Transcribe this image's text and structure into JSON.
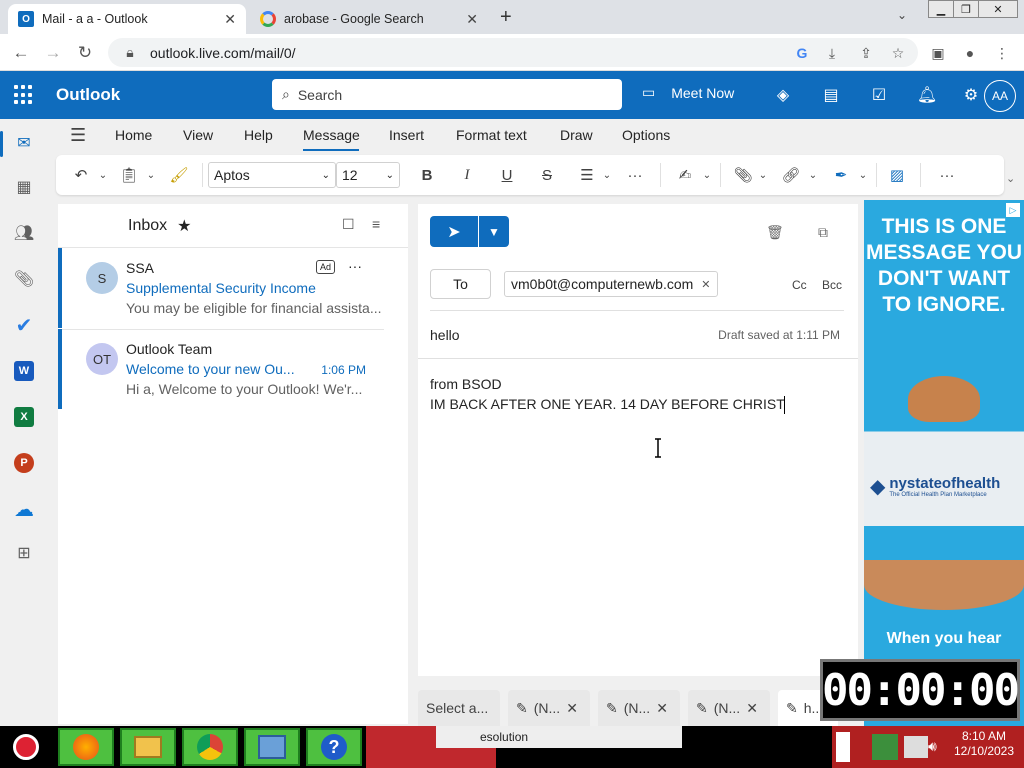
{
  "browser": {
    "tabs": [
      {
        "title": "Mail - a a - Outlook",
        "icon": "outlook-favicon"
      },
      {
        "title": "arobase - Google Search",
        "icon": "google-favicon"
      }
    ],
    "new_tab": "+",
    "url": "outlook.live.com/mail/0/"
  },
  "outlook": {
    "brand": "Outlook",
    "search_placeholder": "Search",
    "meet_now": "Meet Now",
    "avatar_initials": "AA",
    "ribbon_tabs": [
      "Home",
      "View",
      "Help",
      "Message",
      "Insert",
      "Format text",
      "Draw",
      "Options"
    ],
    "font_name": "Aptos",
    "font_size": "12",
    "format_buttons": {
      "bold": "B",
      "italic": "I",
      "underline": "U",
      "strike": "S"
    },
    "more": "···"
  },
  "maillist": {
    "folder": "Inbox",
    "messages": [
      {
        "initials": "S",
        "sender": "SSA",
        "badge": "Ad",
        "subject": "Supplemental Security Income",
        "preview": "You may be eligible for financial assista...",
        "time": "",
        "avatar_color": "#b4cde6"
      },
      {
        "initials": "OT",
        "sender": "Outlook Team",
        "subject": "Welcome to your new Ou...",
        "preview": "Hi a, Welcome to your Outlook! We'r...",
        "time": "1:06 PM",
        "avatar_color": "#c3c7f0"
      }
    ]
  },
  "compose": {
    "to_label": "To",
    "recipient": "vm0b0t@computernewb.com",
    "cc": "Cc",
    "bcc": "Bcc",
    "subject": "hello",
    "draft_status": "Draft saved at 1:11 PM",
    "body_line1": "from BSOD",
    "body_line2": "IM BACK AFTER ONE YEAR. 14 DAY BEFORE CHRIST"
  },
  "ad": {
    "headline": "THIS IS ONE MESSAGE YOU DON'T WANT TO IGNORE.",
    "logo": "nystateofhealth",
    "logo_sub": "The Official Health Plan Marketplace",
    "footer": "When you hear"
  },
  "draft_tabs": [
    "Select a...",
    "(N...",
    "(N...",
    "(N...",
    "h..."
  ],
  "timer": "00:00:00",
  "taskbar": {
    "task_label": "esolution",
    "time": "8:10 AM",
    "date": "12/10/2023"
  }
}
